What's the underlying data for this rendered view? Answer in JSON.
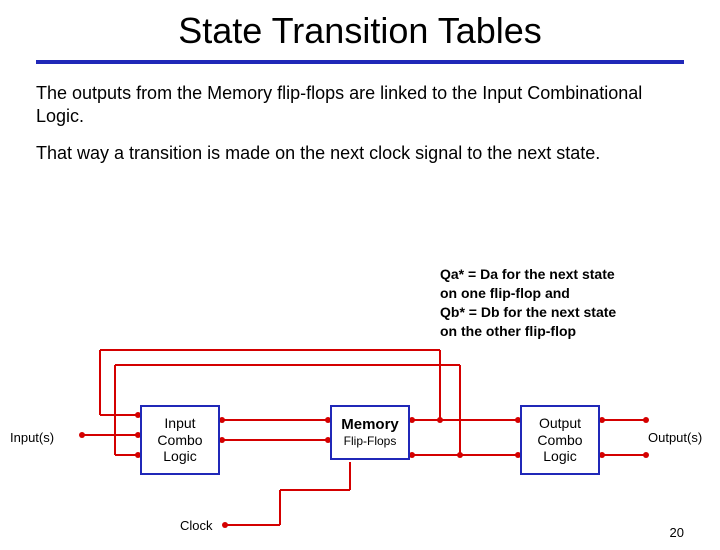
{
  "title": "State Transition Tables",
  "paragraph1": "The outputs from the Memory flip-flops are linked to the Input Combinational Logic.",
  "paragraph2": "That way a transition is made on the next clock signal to the next state.",
  "note": {
    "line1": "Qa* = Da for the next state",
    "line2": "on one flip-flop and",
    "line3": "Qb* = Db for the next state",
    "line4": "on the other flip-flop"
  },
  "diagram": {
    "inputs_label": "Input(s)",
    "outputs_label": "Output(s)",
    "clock_label": "Clock",
    "input_box": {
      "l1": "Input",
      "l2": "Combo",
      "l3": "Logic"
    },
    "memory_box": {
      "title": "Memory",
      "sub": "Flip-Flops"
    },
    "output_box": {
      "l1": "Output",
      "l2": "Combo",
      "l3": "Logic"
    }
  },
  "slide_number": "20"
}
